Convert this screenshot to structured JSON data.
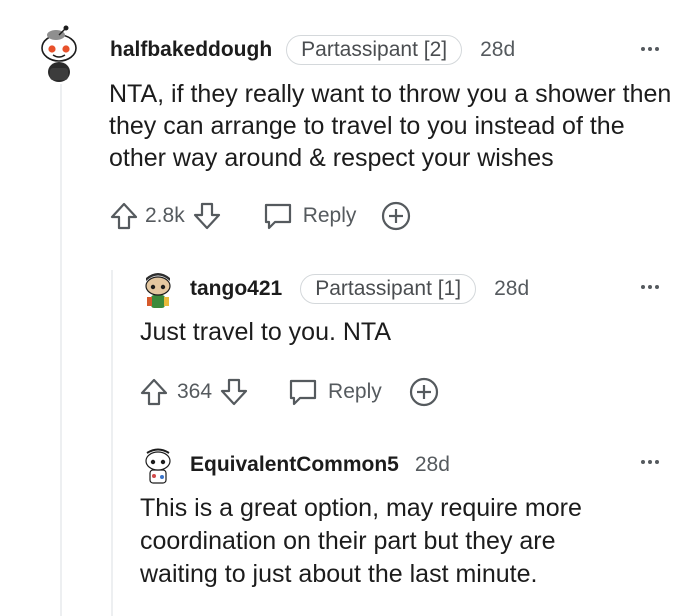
{
  "comments": [
    {
      "username": "halfbakeddough",
      "flair": "Partassipant [2]",
      "timestamp": "28d",
      "body": "NTA, if they really want to throw you a shower then they can arrange to travel to you instead of the other way around & respect your wishes",
      "score": "2.8k",
      "reply_label": "Reply"
    },
    {
      "username": "tango421",
      "flair": "Partassipant [1]",
      "timestamp": "28d",
      "body": "Just travel to you. NTA",
      "score": "364",
      "reply_label": "Reply"
    },
    {
      "username": "EquivalentCommon5",
      "timestamp": "28d",
      "body": "This is a great option, may require more coordination on their part but they are waiting to just about the last minute."
    }
  ],
  "icons": {
    "upvote": "arrow-up-outline",
    "downvote": "arrow-down-outline",
    "reply": "speech-bubble",
    "award": "plus-circle",
    "more": "three-dots-horizontal"
  },
  "colors": {
    "text": "#1c1c1c",
    "meta": "#555a5e",
    "flair_border": "#d4d8db",
    "thread_line": "#edeff1"
  }
}
